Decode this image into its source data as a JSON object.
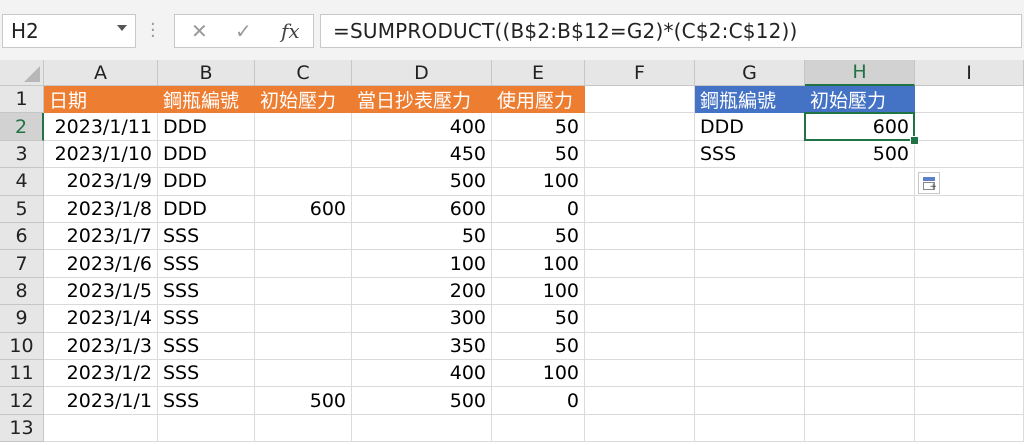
{
  "name_box": "H2",
  "formula_buttons": {
    "cancel": "✕",
    "enter": "✓",
    "fx": "fx"
  },
  "formula": "=SUMPRODUCT((B$2:B$12=G2)*(C$2:C$12))",
  "columns": [
    "A",
    "B",
    "C",
    "D",
    "E",
    "F",
    "G",
    "H",
    "I"
  ],
  "rows": [
    "1",
    "2",
    "3",
    "4",
    "5",
    "6",
    "7",
    "8",
    "9",
    "10",
    "11",
    "12",
    "13"
  ],
  "table1": {
    "headers": [
      "日期",
      "鋼瓶編號",
      "初始壓力",
      "當日抄表壓力",
      "使用壓力"
    ],
    "rows": [
      [
        "2023/1/11",
        "DDD",
        "",
        "400",
        "50"
      ],
      [
        "2023/1/10",
        "DDD",
        "",
        "450",
        "50"
      ],
      [
        "2023/1/9",
        "DDD",
        "",
        "500",
        "100"
      ],
      [
        "2023/1/8",
        "DDD",
        "600",
        "600",
        "0"
      ],
      [
        "2023/1/7",
        "SSS",
        "",
        "50",
        "50"
      ],
      [
        "2023/1/6",
        "SSS",
        "",
        "100",
        "100"
      ],
      [
        "2023/1/5",
        "SSS",
        "",
        "200",
        "100"
      ],
      [
        "2023/1/4",
        "SSS",
        "",
        "300",
        "50"
      ],
      [
        "2023/1/3",
        "SSS",
        "",
        "350",
        "50"
      ],
      [
        "2023/1/2",
        "SSS",
        "",
        "400",
        "100"
      ],
      [
        "2023/1/1",
        "SSS",
        "500",
        "500",
        "0"
      ]
    ]
  },
  "table2": {
    "headers": [
      "鋼瓶編號",
      "初始壓力"
    ],
    "rows": [
      [
        "DDD",
        "600"
      ],
      [
        "SSS",
        "500"
      ]
    ]
  },
  "colors": {
    "orange_header": "#ed7d31",
    "blue_header": "#4472c4",
    "selection": "#217346"
  }
}
